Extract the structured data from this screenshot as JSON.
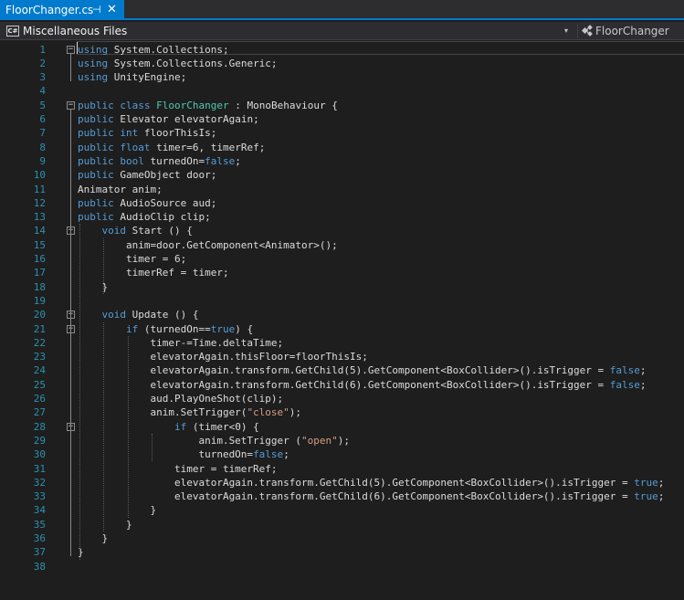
{
  "tab": {
    "filename": "FloorChanger.cs",
    "pin": "⊣",
    "close": "✕"
  },
  "navbar": {
    "project_badge": "C#",
    "project": "Miscellaneous Files",
    "dropdown_arrow": "▾",
    "member": "FloorChanger",
    "member_icon": "class-icon"
  },
  "colors": {
    "accent": "#007acc",
    "keyword": "#569cd6",
    "type": "#4ec9b0",
    "string": "#d69d85",
    "line_number": "#2b91af",
    "text": "#dcdcdc",
    "background": "#1e1e1e"
  },
  "editor": {
    "line_numbers": [
      "1",
      "2",
      "3",
      "4",
      "5",
      "6",
      "7",
      "8",
      "9",
      "10",
      "11",
      "12",
      "13",
      "14",
      "15",
      "16",
      "17",
      "18",
      "19",
      "20",
      "21",
      "22",
      "23",
      "24",
      "25",
      "26",
      "27",
      "28",
      "29",
      "30",
      "31",
      "32",
      "33",
      "34",
      "35",
      "36",
      "37",
      "38"
    ],
    "folds": {
      "1": "−",
      "5": "−",
      "14": "−",
      "20": "−",
      "21": "−",
      "28": "−"
    },
    "lines": [
      [
        [
          "kw",
          "using"
        ],
        [
          "p",
          " System.Collections;"
        ]
      ],
      [
        [
          "kw",
          "using"
        ],
        [
          "p",
          " System.Collections.Generic;"
        ]
      ],
      [
        [
          "kw",
          "using"
        ],
        [
          "p",
          " UnityEngine;"
        ]
      ],
      [],
      [
        [
          "kw",
          "public"
        ],
        [
          "p",
          " "
        ],
        [
          "kw",
          "class"
        ],
        [
          "p",
          " "
        ],
        [
          "ty",
          "FloorChanger"
        ],
        [
          "p",
          " : MonoBehaviour {"
        ]
      ],
      [
        [
          "kw",
          "public"
        ],
        [
          "p",
          " Elevator elevatorAgain;"
        ]
      ],
      [
        [
          "kw",
          "public"
        ],
        [
          "p",
          " "
        ],
        [
          "kw",
          "int"
        ],
        [
          "p",
          " floorThisIs;"
        ]
      ],
      [
        [
          "kw",
          "public"
        ],
        [
          "p",
          " "
        ],
        [
          "kw",
          "float"
        ],
        [
          "p",
          " timer=6, timerRef;"
        ]
      ],
      [
        [
          "kw",
          "public"
        ],
        [
          "p",
          " "
        ],
        [
          "kw",
          "bool"
        ],
        [
          "p",
          " turnedOn="
        ],
        [
          "kw",
          "false"
        ],
        [
          "p",
          ";"
        ]
      ],
      [
        [
          "kw",
          "public"
        ],
        [
          "p",
          " GameObject door;"
        ]
      ],
      [
        [
          "p",
          "Animator anim;"
        ]
      ],
      [
        [
          "kw",
          "public"
        ],
        [
          "p",
          " AudioSource aud;"
        ]
      ],
      [
        [
          "kw",
          "public"
        ],
        [
          "p",
          " AudioClip clip;"
        ]
      ],
      [
        [
          "p",
          "    "
        ],
        [
          "kw",
          "void"
        ],
        [
          "p",
          " Start () {"
        ]
      ],
      [
        [
          "p",
          "        anim=door.GetComponent<Animator>();"
        ]
      ],
      [
        [
          "p",
          "        timer = 6;"
        ]
      ],
      [
        [
          "p",
          "        timerRef = timer;"
        ]
      ],
      [
        [
          "p",
          "    }"
        ]
      ],
      [],
      [
        [
          "p",
          "    "
        ],
        [
          "kw",
          "void"
        ],
        [
          "p",
          " Update () {"
        ]
      ],
      [
        [
          "p",
          "        "
        ],
        [
          "kw",
          "if"
        ],
        [
          "p",
          " (turnedOn=="
        ],
        [
          "kw",
          "true"
        ],
        [
          "p",
          ") {"
        ]
      ],
      [
        [
          "p",
          "            timer-=Time.deltaTime;"
        ]
      ],
      [
        [
          "p",
          "            elevatorAgain.thisFloor=floorThisIs;"
        ]
      ],
      [
        [
          "p",
          "            elevatorAgain.transform.GetChild(5).GetComponent<BoxCollider>().isTrigger = "
        ],
        [
          "kw",
          "false"
        ],
        [
          "p",
          ";"
        ]
      ],
      [
        [
          "p",
          "            elevatorAgain.transform.GetChild(6).GetComponent<BoxCollider>().isTrigger = "
        ],
        [
          "kw",
          "false"
        ],
        [
          "p",
          ";"
        ]
      ],
      [
        [
          "p",
          "            aud.PlayOneShot(clip);"
        ]
      ],
      [
        [
          "p",
          "            anim.SetTrigger("
        ],
        [
          "str",
          "\"close\""
        ],
        [
          "p",
          ");"
        ]
      ],
      [
        [
          "p",
          "                "
        ],
        [
          "kw",
          "if"
        ],
        [
          "p",
          " (timer<0) {"
        ]
      ],
      [
        [
          "p",
          "                    anim.SetTrigger ("
        ],
        [
          "str",
          "\"open\""
        ],
        [
          "p",
          ");"
        ]
      ],
      [
        [
          "p",
          "                    turnedOn="
        ],
        [
          "kw",
          "false"
        ],
        [
          "p",
          ";"
        ]
      ],
      [
        [
          "p",
          "                timer = timerRef;"
        ]
      ],
      [
        [
          "p",
          "                elevatorAgain.transform.GetChild(5).GetComponent<BoxCollider>().isTrigger = "
        ],
        [
          "kw",
          "true"
        ],
        [
          "p",
          ";"
        ]
      ],
      [
        [
          "p",
          "                elevatorAgain.transform.GetChild(6).GetComponent<BoxCollider>().isTrigger = "
        ],
        [
          "kw",
          "true"
        ],
        [
          "p",
          ";"
        ]
      ],
      [
        [
          "p",
          "            }"
        ]
      ],
      [
        [
          "p",
          "        }"
        ]
      ],
      [
        [
          "p",
          "    }"
        ]
      ],
      [
        [
          "p",
          "}"
        ]
      ],
      []
    ]
  }
}
